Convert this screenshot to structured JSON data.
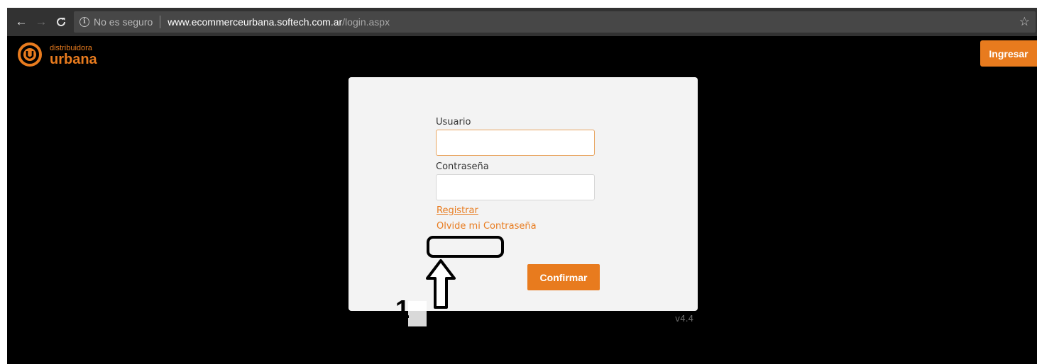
{
  "browser": {
    "back_icon": "arrow-left-icon",
    "forward_icon": "arrow-right-icon",
    "reload_icon": "reload-icon",
    "security_text": "No es seguro",
    "url_host": "www.ecommerceurbana.softech.com.ar",
    "url_path": "/login.aspx",
    "star_icon": "bookmark-star-icon"
  },
  "header": {
    "logo_small": "distribuidora",
    "logo_large": "urbana",
    "login_button": "Ingresar"
  },
  "login": {
    "user_label": "Usuario",
    "user_value": "",
    "password_label": "Contraseña",
    "password_value": "",
    "register_link": "Registrar",
    "forgot_link": "Olvide mi Contraseña",
    "confirm_button": "Confirmar"
  },
  "footer": {
    "version": "v4.4"
  },
  "annotation": {
    "step_number": "1"
  },
  "colors": {
    "accent": "#e87b1e",
    "page_bg": "#000000",
    "card_bg": "#f3f3f3",
    "toolbar_bg": "#323232"
  }
}
